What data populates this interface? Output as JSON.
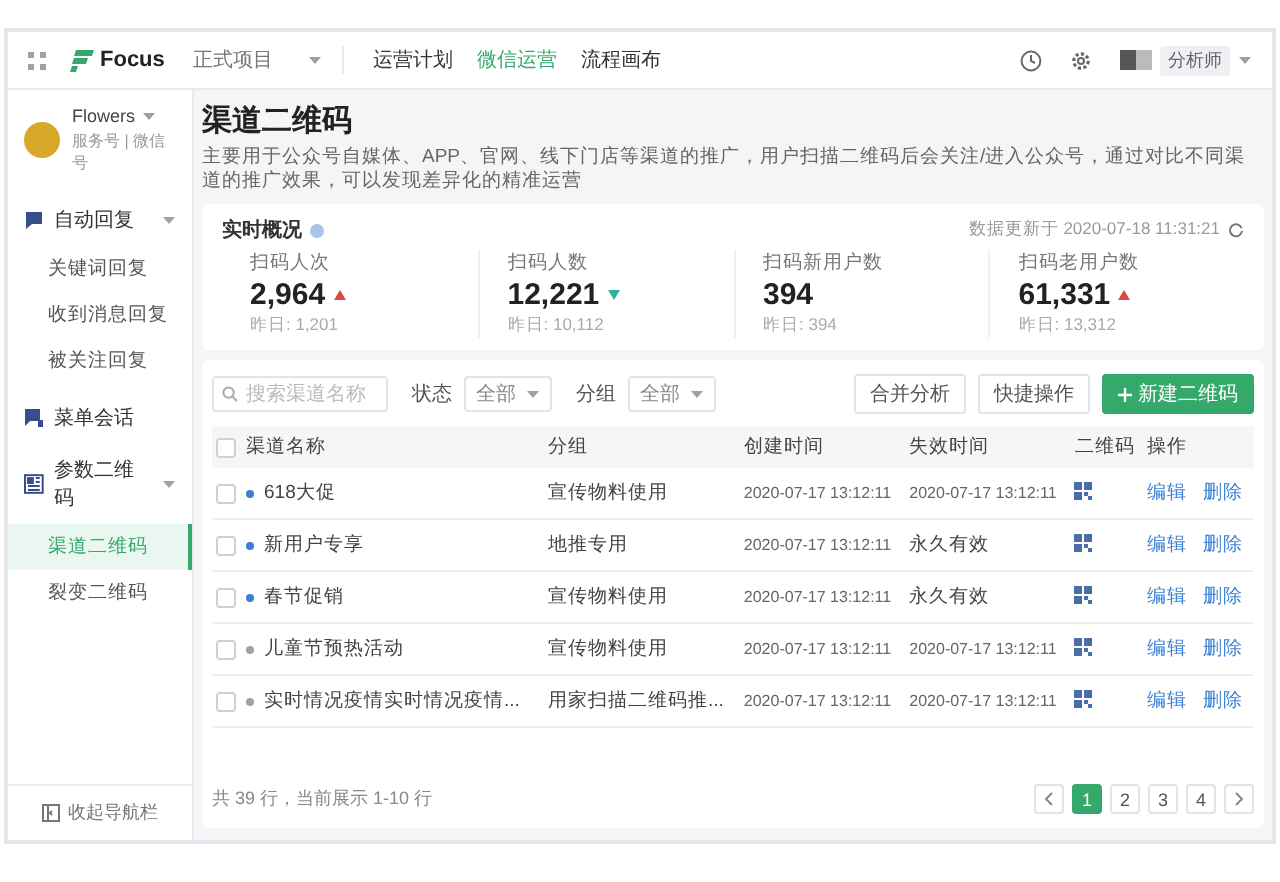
{
  "topbar": {
    "logo": "Focus",
    "project": "正式项目",
    "nav": [
      {
        "label": "运营计划",
        "selected": false
      },
      {
        "label": "微信运营",
        "selected": true
      },
      {
        "label": "流程画布",
        "selected": false
      }
    ],
    "user": "分析师"
  },
  "sidebar": {
    "account": {
      "name": "Flowers",
      "meta": "服务号 | 微信号"
    },
    "groups": [
      {
        "label": "自动回复",
        "expanded": true,
        "children": [
          {
            "label": "关键词回复",
            "selected": false
          },
          {
            "label": "收到消息回复",
            "selected": false
          },
          {
            "label": "被关注回复",
            "selected": false
          }
        ]
      },
      {
        "label": "菜单会话"
      },
      {
        "label": "参数二维码",
        "expanded": true,
        "children": [
          {
            "label": "渠道二维码",
            "selected": true
          },
          {
            "label": "裂变二维码",
            "selected": false
          }
        ]
      }
    ],
    "collapse": "收起导航栏"
  },
  "page": {
    "title": "渠道二维码",
    "description": "主要用于公众号自媒体、APP、官网、线下门店等渠道的推广，用户扫描二维码后会关注/进入公众号，通过对比不同渠道的推广效果，可以发现差异化的精准运营"
  },
  "overview": {
    "title": "实时概况",
    "updated": "数据更新于 2020-07-18 11:31:21",
    "stats": [
      {
        "label": "扫码人次",
        "value": "2,964",
        "kind": "up",
        "yesterday": "昨日: 1,201"
      },
      {
        "label": "扫码人数",
        "value": "12,221",
        "kind": "down",
        "yesterday": "昨日: 10,112"
      },
      {
        "label": "扫码新用户数",
        "value": "394",
        "kind": "flat",
        "yesterday": "昨日: 394"
      },
      {
        "label": "扫码老用户数",
        "value": "61,331",
        "kind": "up",
        "yesterday": "昨日: 13,312"
      }
    ]
  },
  "toolbar": {
    "search": {
      "placeholder": "搜索渠道名称"
    },
    "filters": [
      {
        "label": "状态",
        "value": "全部"
      },
      {
        "label": "分组",
        "value": "全部"
      }
    ],
    "buttons": [
      {
        "label": "合并分析",
        "kind": "default"
      },
      {
        "label": "快捷操作",
        "kind": "default"
      },
      {
        "label": "新建二维码",
        "kind": "primary"
      }
    ]
  },
  "table": {
    "select_all_checked": false,
    "columns": [
      "渠道名称",
      "分组",
      "创建时间",
      "失效时间",
      "二维码",
      "操作"
    ],
    "rows": [
      {
        "checked": false,
        "color": "#3b7fd4",
        "name": "618大促",
        "group": "宣传物料使用",
        "created": "2020-07-17 13:12:11",
        "expires": "2020-07-17 13:12:11",
        "actions": [
          "编辑",
          "删除"
        ]
      },
      {
        "checked": false,
        "color": "#3b7fd4",
        "name": "新用户专享",
        "group": "地推专用",
        "created": "2020-07-17 13:12:11",
        "expires": "永久有效",
        "actions": [
          "编辑",
          "删除"
        ]
      },
      {
        "checked": false,
        "color": "#3b7fd4",
        "name": "春节促销",
        "group": "宣传物料使用",
        "created": "2020-07-17 13:12:11",
        "expires": "永久有效",
        "actions": [
          "编辑",
          "删除"
        ]
      },
      {
        "checked": false,
        "color": "#9aa1ab",
        "name": "儿童节预热活动",
        "group": "宣传物料使用",
        "created": "2020-07-17 13:12:11",
        "expires": "2020-07-17 13:12:11",
        "actions": [
          "编辑",
          "删除"
        ]
      },
      {
        "checked": false,
        "color": "#9aa1ab",
        "name": "实时情况疫情实时情况疫情...",
        "group": "用家扫描二维码推...",
        "created": "2020-07-17 13:12:11",
        "expires": "2020-07-17 13:12:11",
        "actions": [
          "编辑",
          "删除"
        ]
      }
    ],
    "summary": "共 39 行，当前展示 1-10 行",
    "pages": [
      {
        "label": "1",
        "selected": true
      },
      {
        "label": "2",
        "selected": false
      },
      {
        "label": "3",
        "selected": false
      },
      {
        "label": "4",
        "selected": false
      }
    ]
  }
}
